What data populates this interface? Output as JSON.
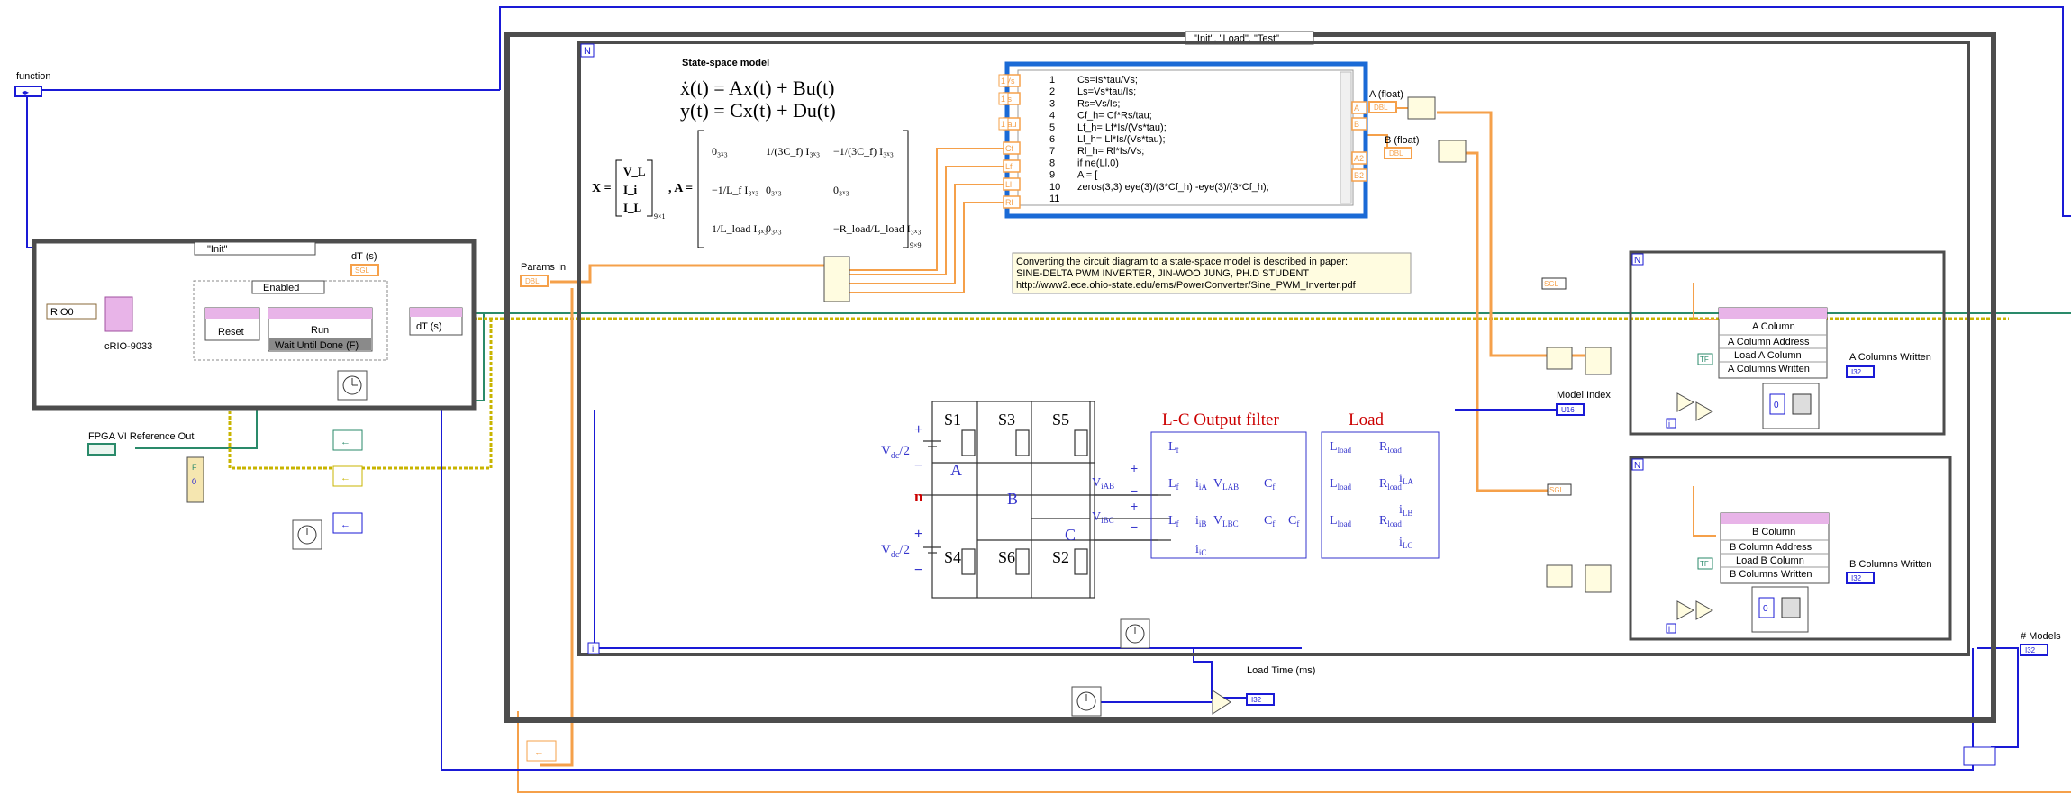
{
  "controls": {
    "function_label": "function",
    "params_in_label": "Params In",
    "fpga_ref_label": "FPGA VI Reference Out",
    "dt_label": "dT (s)",
    "model_index_label": "Model Index",
    "a_columns_written_label": "A Columns Written",
    "b_columns_written_label": "B Columns Written",
    "models_label": "# Models",
    "load_time_label": "Load\nTime (ms)",
    "a_float_label": "A (float)",
    "b_float_label": "B (float)"
  },
  "case_structures": {
    "outer_selector": "\"Init\", \"Load\", \"Test\"",
    "inner_selector": "\"Init\"",
    "enabled_selector": "Enabled"
  },
  "init_case": {
    "rio_resource": "RIO0",
    "target": "cRIO-9033",
    "reset_label": "Reset",
    "run_label": "Run",
    "wait_until_done": "Wait Until Done (F)",
    "dt_tag": "dT (s)"
  },
  "state_space": {
    "title": "State-space model",
    "eq1": "ẋ(t) = Ax(t) + Bu(t)",
    "eq2": "y(t) = Cx(t) + Du(t)",
    "x_def": "X =",
    "x_vector": [
      "V_L",
      "I_i",
      "I_L"
    ],
    "x_subscript": "9×1",
    "a_def": ", A =",
    "a_subscript": "9×9",
    "a_matrix": [
      [
        "0₃ₓ₃",
        "1/(3C_f) I₃ₓ₃",
        "−1/(3C_f) I₃ₓ₃"
      ],
      [
        "−1/L_f I₃ₓ₃",
        "0₃ₓ₃",
        "0₃ₓ₃"
      ],
      [
        "1/L_load I₃ₓ₃",
        "0₃ₓ₃",
        "−R_load/L_load I₃ₓ₃"
      ]
    ]
  },
  "mathscript": {
    "inputs": [
      "Vs",
      "Is",
      "tau",
      "Cf",
      "Lf",
      "Ll",
      "Rl"
    ],
    "outputs": [
      "A",
      "B",
      "A2",
      "B2"
    ],
    "lines": [
      {
        "n": "1",
        "code": "Cs=Is*tau/Vs;"
      },
      {
        "n": "2",
        "code": "Ls=Vs*tau/Is;"
      },
      {
        "n": "3",
        "code": "Rs=Vs/Is;"
      },
      {
        "n": "4",
        "code": "Cf_h= Cf*Rs/tau;"
      },
      {
        "n": "5",
        "code": "Lf_h= Lf*Is/(Vs*tau);"
      },
      {
        "n": "6",
        "code": "Ll_h= Ll*Is/(Vs*tau);"
      },
      {
        "n": "7",
        "code": "Rl_h= Rl*Is/Vs;"
      },
      {
        "n": "8",
        "code": "if ne(Ll,0)"
      },
      {
        "n": "9",
        "code": "A = ["
      },
      {
        "n": "10",
        "code": "zeros(3,3) eye(3)/(3*Cf_h) -eye(3)/(3*Cf_h);"
      },
      {
        "n": "11",
        "code": ""
      }
    ]
  },
  "comment": {
    "line1": "Converting the circuit diagram to a state-space model is described in paper:",
    "line2": "SINE-DELTA PWM INVERTER, JIN-WOO JUNG, PH.D STUDENT",
    "line3": "http://www2.ece.ohio-state.edu/ems/PowerConverter/Sine_PWM_Inverter.pdf"
  },
  "circuit": {
    "lc_filter_label": "L-C Output filter",
    "load_label": "Load",
    "switches": [
      "S1",
      "S3",
      "S5",
      "S4",
      "S6",
      "S2"
    ],
    "nodes": [
      "A",
      "B",
      "C",
      "n"
    ],
    "vdc": "V",
    "vdc_sub": "dc",
    "vdc_half": "/2",
    "labels": {
      "Lf": "L",
      "Cf": "C",
      "Lload": "L",
      "Rload": "R",
      "ViAB": "V",
      "ViBC": "V",
      "VLAB": "V",
      "VLBC": "V",
      "iA": "i",
      "iB": "i",
      "iC": "i",
      "iLA": "i",
      "iLB": "i",
      "iLC": "i"
    },
    "subs": {
      "f": "f",
      "load": "load",
      "iAB": "iAB",
      "iBC": "iBC",
      "LAB": "LAB",
      "LBC": "LBC",
      "iA": "iA",
      "iB": "iB",
      "iC": "iC",
      "LA": "LA",
      "LB": "LB",
      "LC": "LC"
    }
  },
  "a_write": {
    "property": "A Column",
    "items": [
      "A Column Address",
      "Load A Column",
      "A Columns Written"
    ],
    "bool": "TF",
    "i32": "I32",
    "sgl": "SGL",
    "index": "0"
  },
  "b_write": {
    "property": "B Column",
    "items": [
      "B Column Address",
      "Load B Column",
      "B Columns Written"
    ],
    "bool": "TF",
    "i32": "I32",
    "sgl": "SGL",
    "index": "0"
  },
  "terminals": {
    "dbl": "DBL",
    "u16": "U16",
    "i32": "I32",
    "sgl": "SGL",
    "loop_n": "N",
    "loop_i": "i",
    "array_index": "0",
    "bool_f": "F"
  },
  "colors": {
    "structure_border": "#4d4d4d",
    "wire_orange": "#f5a04a",
    "wire_blue": "#1a1ad6",
    "wire_green": "#2a8a6a",
    "wire_yellow": "#c8b400",
    "pink_node": "#e8b4e8",
    "circuit_blue": "#3333cc",
    "circuit_red": "#cc0000"
  }
}
